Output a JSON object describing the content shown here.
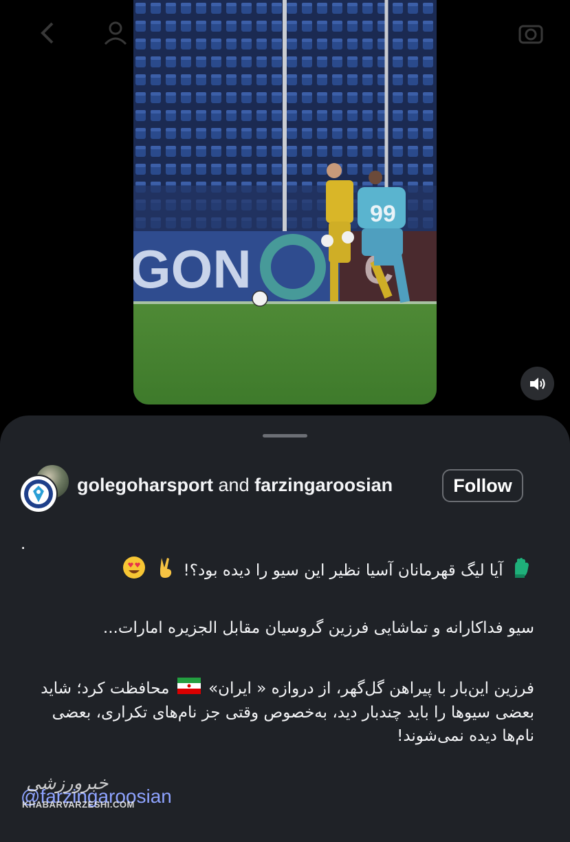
{
  "post": {
    "account_primary": "golegoharsport",
    "connector": "and",
    "account_collab": "farzingaroosian",
    "follow_label": "Follow"
  },
  "video_overlay": {
    "banner_text": "GON",
    "jersey_number": "99"
  },
  "caption": {
    "dot": ".",
    "line1": "آیا لیگ قهرمانان آسیا نظیر این سیو را دیده بود؟!",
    "line2": "سیو فداکارانه و تماشایی فرزین گروسیان مقابل الجزیره امارات...",
    "para_part1": "فرزین این‌بار با پیراهن گل‌گهر، از دروازه « ایران»",
    "para_part2": "محافظت کرد؛ شاید بعضی سیوها را باید چندبار دید، به‌خصوص وقتی جز نام‌های تکراری، بعضی نام‌ها دیده نمی‌شوند!",
    "mention": "@farzingaroosian"
  },
  "watermark": {
    "script": "خبرورزشی",
    "text": "KHABARVARZESHI.COM"
  },
  "icons": {
    "back": "chevron-left-icon",
    "profile": "person-icon",
    "camera": "camera-icon",
    "sound": "speaker-icon",
    "glove": "goalkeeper-glove-emoji",
    "victory": "victory-hand-emoji",
    "love": "heart-eyes-emoji",
    "flag": "iran-flag-emoji"
  },
  "colors": {
    "sheet_bg": "#1f2227",
    "link": "#8ea3ff",
    "follow_border": "#6a6d72"
  }
}
